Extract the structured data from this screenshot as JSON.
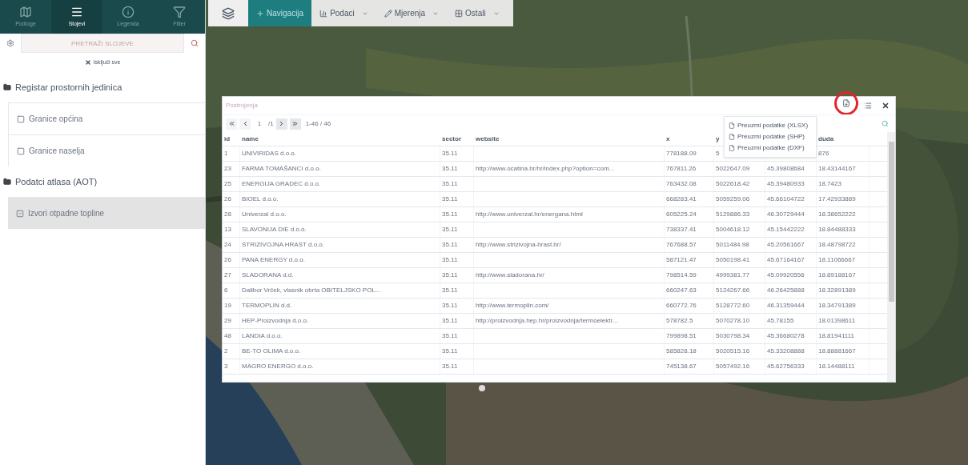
{
  "sidebar": {
    "tabs": [
      {
        "label": "Podloge",
        "selected": false
      },
      {
        "label": "Slojevi",
        "selected": true
      },
      {
        "label": "Legenda",
        "selected": false
      },
      {
        "label": "Filter",
        "selected": false
      }
    ],
    "search": {
      "placeholder": "PRETRAŽI SLOJEVE"
    },
    "clear_all": "Isključi sve",
    "tree": [
      {
        "label": "Registar prostornih jedinica",
        "children": [
          {
            "label": "Granice općina",
            "checked": false,
            "selected": false
          },
          {
            "label": "Granice naselja",
            "checked": false,
            "selected": false
          }
        ]
      },
      {
        "label": "Podatci atlasa (AOT)",
        "children": [
          {
            "label": "Izvori otpadne topline",
            "checked": true,
            "selected": true
          }
        ]
      }
    ]
  },
  "toolbar": [
    {
      "kind": "icon",
      "selected": false
    },
    {
      "kind": "button",
      "label": "Navigacija",
      "selected": true
    },
    {
      "kind": "dropdown",
      "label": "Podaci",
      "selected": false
    },
    {
      "kind": "dropdown",
      "label": "Mjerenja",
      "selected": false
    },
    {
      "kind": "dropdown",
      "label": "Ostali",
      "selected": false
    }
  ],
  "panel": {
    "title": "Postrojenja",
    "pager": {
      "page": "1",
      "pages": "/1",
      "range": "1-46 / 46"
    },
    "export_menu": [
      "Preuzmi podatke (XLSX)",
      "Preuzmi podatke (SHP)",
      "Preuzmi podatke (DXF)"
    ],
    "columns": [
      "id",
      "name",
      "sector",
      "website",
      "x",
      "y",
      null,
      "duda"
    ],
    "rows": [
      [
        "1",
        "UNIVIRIDAS d.o.o.",
        "35.11",
        null,
        "778188.09",
        "5",
        null,
        "876"
      ],
      [
        "23",
        "FARMA TOMAŠANCI d.o.o.",
        "35.11",
        "http://www.ocatina.hr/hr/index.php?option=com...",
        "767811.26",
        "5022647.09",
        "45.39808684",
        "18.43144167"
      ],
      [
        "25",
        "ENERGIJA GRADEC d.o.o.",
        "35.11",
        null,
        "763432.08",
        "5022618.42",
        "45.39480933",
        "18.7423"
      ],
      [
        "26",
        "BIOEL d.o.o.",
        "35.11",
        null,
        "668283.41",
        "5059259.06",
        "45.66104722",
        "17.42933889"
      ],
      [
        "28",
        "Univerzal d.o.o.",
        "35.11",
        "http://www.univerzal.hr/energana.html",
        "605225.24",
        "5129886.33",
        "46.30729444",
        "18.38652222"
      ],
      [
        "13",
        "SLAVONIJA DIE d.o.o.",
        "35.11",
        null,
        "738337.41",
        "5004618.12",
        "45.15442222",
        "18.84488333"
      ],
      [
        "24",
        "STRIZIVOJNA HRAST d.o.o.",
        "35.11",
        "http://www.strizivojna-hrast.hr/",
        "767688.57",
        "5011484.98",
        "45.20561667",
        "18.48798722"
      ],
      [
        "26",
        "PANA ENERGY d.o.o.",
        "35.11",
        null,
        "587121.47",
        "5050198.41",
        "45.67164167",
        "18.11066667"
      ],
      [
        "27",
        "SLADORANA d.d.",
        "35.11",
        "http://www.sladorana.hr/",
        "798514.59",
        "4999381.77",
        "45.09920556",
        "18.89188167"
      ],
      [
        "6",
        "Dalibor Vrček, vlasnik obrta OBITELJSKO POL...",
        "35.11",
        null,
        "660247.63",
        "5124267.66",
        "46.26425888",
        "18.32891389"
      ],
      [
        "19",
        "TERMOPLIN d.d.",
        "35.11",
        "http://www.termoplin.com/",
        "660772.76",
        "5128772.60",
        "46.31359444",
        "18.34791389"
      ],
      [
        "29",
        "HEP-Proizvodnja d.o.o.",
        "35.11",
        "http://proizvodnja.hep.hr/proizvodnja/termoelektr...",
        "578782.5",
        "5070278.10",
        "45.78155",
        "18.01398611"
      ],
      [
        "48",
        "LANDIA d.o.o.",
        "35.11",
        null,
        "799898.51",
        "5030798.34",
        "45.36680278",
        "18.81941111"
      ],
      [
        "2",
        "BE-TO OLIMA d.o.o.",
        "35.11",
        null,
        "585828.18",
        "5020515.16",
        "45.33208888",
        "18.88881667"
      ],
      [
        "3",
        "MAGRO ENERGO d.o.o.",
        "35.11",
        null,
        "745138.67",
        "5057492.16",
        "45.62756333",
        "18.14488111"
      ]
    ]
  }
}
